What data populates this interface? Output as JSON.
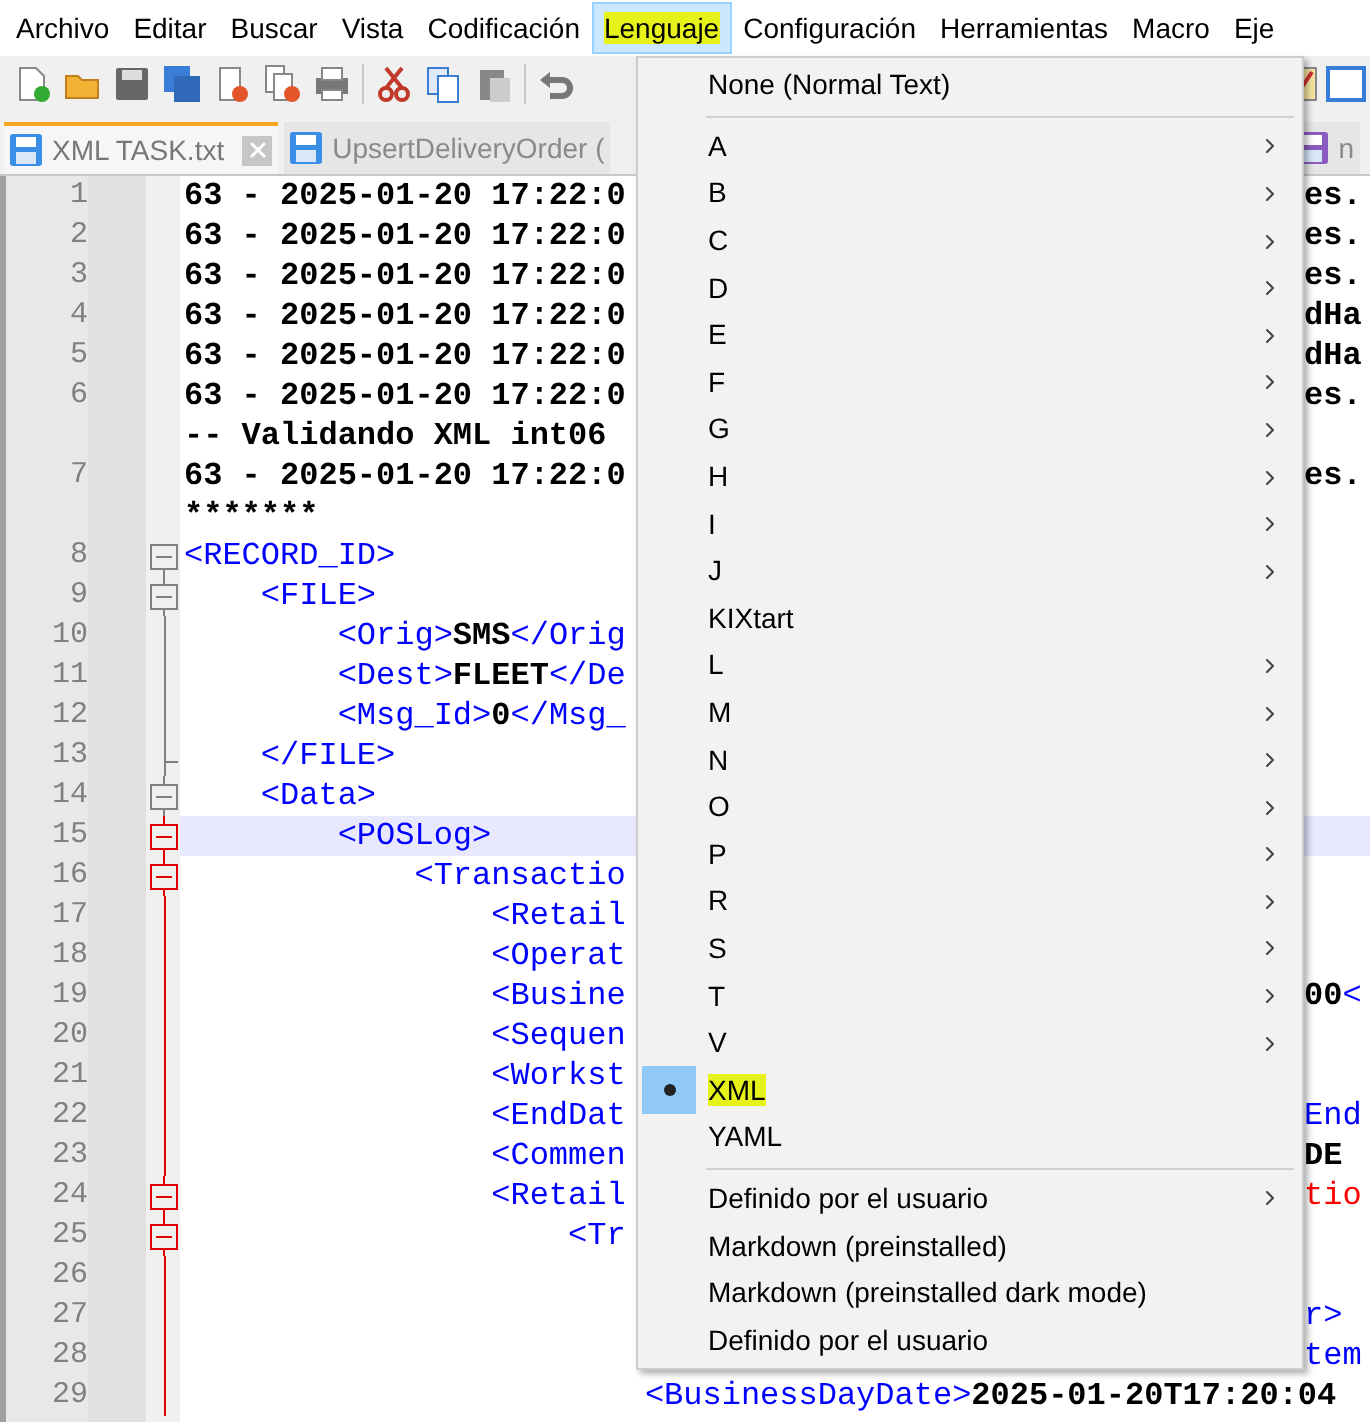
{
  "menubar": [
    {
      "label": "Archivo",
      "open": false,
      "highlighted": false
    },
    {
      "label": "Editar",
      "open": false,
      "highlighted": false
    },
    {
      "label": "Buscar",
      "open": false,
      "highlighted": false
    },
    {
      "label": "Vista",
      "open": false,
      "highlighted": false
    },
    {
      "label": "Codificación",
      "open": false,
      "highlighted": false
    },
    {
      "label": "Lenguaje",
      "open": true,
      "highlighted": true
    },
    {
      "label": "Configuración",
      "open": false,
      "highlighted": false
    },
    {
      "label": "Herramientas",
      "open": false,
      "highlighted": false
    },
    {
      "label": "Macro",
      "open": false,
      "highlighted": false
    },
    {
      "label": "Eje",
      "open": false,
      "highlighted": false
    }
  ],
  "tabs": [
    {
      "label": "XML TASK.txt",
      "selected": true,
      "color": "#3a8ee6"
    },
    {
      "label": "UpsertDeliveryOrder (",
      "selected": false,
      "color": "#3a8ee6"
    },
    {
      "label": "n",
      "selected": false,
      "color": "#8a5cc0"
    }
  ],
  "editor": {
    "lines": [
      {
        "number": "1",
        "current": false,
        "left": [
          {
            "kind": "text",
            "text": "63 - 2025-01-20 17:22:0"
          }
        ],
        "right": [
          {
            "kind": "text",
            "text": "es."
          }
        ]
      },
      {
        "number": "2",
        "current": false,
        "left": [
          {
            "kind": "text",
            "text": "63 - 2025-01-20 17:22:0"
          }
        ],
        "right": [
          {
            "kind": "text",
            "text": "es."
          }
        ]
      },
      {
        "number": "3",
        "current": false,
        "left": [
          {
            "kind": "text",
            "text": "63 - 2025-01-20 17:22:0"
          }
        ],
        "right": [
          {
            "kind": "text",
            "text": "es."
          }
        ]
      },
      {
        "number": "4",
        "current": false,
        "left": [
          {
            "kind": "text",
            "text": "63 - 2025-01-20 17:22:0"
          }
        ],
        "right": [
          {
            "kind": "text",
            "text": "dHa"
          }
        ]
      },
      {
        "number": "5",
        "current": false,
        "left": [
          {
            "kind": "text",
            "text": "63 - 2025-01-20 17:22:0"
          }
        ],
        "right": [
          {
            "kind": "text",
            "text": "dHa"
          }
        ]
      },
      {
        "number": "6",
        "current": false,
        "left": [
          {
            "kind": "text",
            "text": "63 - 2025-01-20 17:22:0"
          }
        ],
        "right": [
          {
            "kind": "text",
            "text": "es."
          }
        ]
      },
      {
        "current": false,
        "left": [
          {
            "kind": "text",
            "text": "-- Validando XML int06"
          }
        ]
      },
      {
        "number": "7",
        "current": false,
        "left": [
          {
            "kind": "text",
            "text": "63 - 2025-01-20 17:22:0"
          }
        ],
        "right": [
          {
            "kind": "text",
            "text": "es."
          }
        ]
      },
      {
        "current": false,
        "left": [
          {
            "kind": "text",
            "text": "*******"
          }
        ]
      },
      {
        "number": "8",
        "kind": "fold_root",
        "current": false,
        "current_block": false,
        "left": [
          {
            "kind": "tag",
            "text": "<RECORD_ID>"
          }
        ]
      },
      {
        "number": "9",
        "kind": "fold_open",
        "current": false,
        "current_block": false,
        "left": [
          {
            "kind": "tag",
            "text": "    <FILE>"
          }
        ]
      },
      {
        "number": "10",
        "kind": "fold_line",
        "current": false,
        "current_block": false,
        "left": [
          {
            "kind": "tag",
            "text": "        <Orig>"
          },
          {
            "kind": "text",
            "text": "SMS"
          },
          {
            "kind": "tag",
            "text": "</Orig"
          }
        ]
      },
      {
        "number": "11",
        "kind": "fold_line",
        "current": false,
        "current_block": false,
        "left": [
          {
            "kind": "tag",
            "text": "        <Dest>"
          },
          {
            "kind": "text",
            "text": "FLEET"
          },
          {
            "kind": "tag",
            "text": "</De"
          }
        ]
      },
      {
        "number": "12",
        "kind": "fold_line",
        "current": false,
        "current_block": false,
        "left": [
          {
            "kind": "tag",
            "text": "        <Msg_Id>"
          },
          {
            "kind": "text",
            "text": "0"
          },
          {
            "kind": "tag",
            "text": "</Msg_"
          }
        ]
      },
      {
        "number": "13",
        "kind": "fold_end",
        "current": false,
        "current_block": false,
        "left": [
          {
            "kind": "tag",
            "text": "    </FILE>"
          }
        ]
      },
      {
        "number": "14",
        "kind": "fold_open",
        "current": false,
        "current_block": false,
        "left": [
          {
            "kind": "tag",
            "text": "    <Data>"
          }
        ]
      },
      {
        "number": "15",
        "kind": "fold_open",
        "current": true,
        "current_block": true,
        "left": [
          {
            "kind": "tag",
            "text": "        <POSLog>"
          }
        ]
      },
      {
        "number": "16",
        "kind": "fold_open",
        "current": false,
        "current_block": true,
        "left": [
          {
            "kind": "tag",
            "text": "            <Transactio"
          }
        ]
      },
      {
        "number": "17",
        "kind": "fold_line",
        "current": false,
        "current_block": true,
        "left": [
          {
            "kind": "tag",
            "text": "                <Retail"
          }
        ]
      },
      {
        "number": "18",
        "kind": "fold_line",
        "current": false,
        "current_block": true,
        "left": [
          {
            "kind": "tag",
            "text": "                <Operat"
          }
        ]
      },
      {
        "number": "19",
        "kind": "fold_line",
        "current": false,
        "current_block": true,
        "left": [
          {
            "kind": "tag",
            "text": "                <Busine"
          }
        ],
        "right": [
          {
            "kind": "text",
            "text": "00"
          },
          {
            "kind": "tag",
            "text": "<"
          }
        ]
      },
      {
        "number": "20",
        "kind": "fold_line",
        "current": false,
        "current_block": true,
        "left": [
          {
            "kind": "tag",
            "text": "                <Sequen"
          }
        ]
      },
      {
        "number": "21",
        "kind": "fold_line",
        "current": false,
        "current_block": true,
        "left": [
          {
            "kind": "tag",
            "text": "                <Workst"
          }
        ]
      },
      {
        "number": "22",
        "kind": "fold_line",
        "current": false,
        "current_block": true,
        "left": [
          {
            "kind": "tag",
            "text": "                <EndDat"
          }
        ],
        "right": [
          {
            "kind": "tag",
            "text": "End"
          }
        ]
      },
      {
        "number": "23",
        "kind": "fold_line",
        "current": false,
        "current_block": true,
        "left": [
          {
            "kind": "tag",
            "text": "                <Commen"
          }
        ],
        "right": [
          {
            "kind": "text",
            "text": "DE"
          }
        ]
      },
      {
        "number": "24",
        "kind": "fold_open",
        "current": false,
        "current_block": true,
        "left": [
          {
            "kind": "tag",
            "text": "                <Retail"
          }
        ],
        "right": [
          {
            "kind": "attr",
            "text": "tio"
          }
        ]
      },
      {
        "number": "25",
        "kind": "fold_open",
        "current": false,
        "current_block": true,
        "left": [
          {
            "kind": "tag",
            "text": "                    <Tr"
          }
        ]
      },
      {
        "number": "26",
        "kind": "fold_line",
        "current": false,
        "current_block": true
      },
      {
        "number": "27",
        "kind": "fold_line",
        "current": false,
        "current_block": true,
        "right": [
          {
            "kind": "tag",
            "text": "r>"
          }
        ]
      },
      {
        "number": "28",
        "kind": "fold_line",
        "current": false,
        "current_block": true,
        "right": [
          {
            "kind": "tag",
            "text": "tem"
          }
        ]
      },
      {
        "number": "29",
        "kind": "fold_line",
        "current": false,
        "current_block": true,
        "left": [
          {
            "kind": "tag",
            "text": "                        <BusinessDayDate>"
          },
          {
            "kind": "text",
            "text": "2025-01-20T17:20:04"
          }
        ]
      }
    ]
  },
  "language_menu": {
    "items": [
      {
        "kind": "item",
        "label": "None (Normal Text)",
        "submenu": false,
        "selected": false,
        "highlighted": false
      },
      {
        "kind": "separator"
      },
      {
        "kind": "item",
        "label": "A",
        "submenu": true,
        "selected": false,
        "highlighted": false
      },
      {
        "kind": "item",
        "label": "B",
        "submenu": true,
        "selected": false,
        "highlighted": false
      },
      {
        "kind": "item",
        "label": "C",
        "submenu": true,
        "selected": false,
        "highlighted": false
      },
      {
        "kind": "item",
        "label": "D",
        "submenu": true,
        "selected": false,
        "highlighted": false
      },
      {
        "kind": "item",
        "label": "E",
        "submenu": true,
        "selected": false,
        "highlighted": false
      },
      {
        "kind": "item",
        "label": "F",
        "submenu": true,
        "selected": false,
        "highlighted": false
      },
      {
        "kind": "item",
        "label": "G",
        "submenu": true,
        "selected": false,
        "highlighted": false
      },
      {
        "kind": "item",
        "label": "H",
        "submenu": true,
        "selected": false,
        "highlighted": false
      },
      {
        "kind": "item",
        "label": "I",
        "submenu": true,
        "selected": false,
        "highlighted": false
      },
      {
        "kind": "item",
        "label": "J",
        "submenu": true,
        "selected": false,
        "highlighted": false
      },
      {
        "kind": "item",
        "label": "KIXtart",
        "submenu": false,
        "selected": false,
        "highlighted": false
      },
      {
        "kind": "item",
        "label": "L",
        "submenu": true,
        "selected": false,
        "highlighted": false
      },
      {
        "kind": "item",
        "label": "M",
        "submenu": true,
        "selected": false,
        "highlighted": false
      },
      {
        "kind": "item",
        "label": "N",
        "submenu": true,
        "selected": false,
        "highlighted": false
      },
      {
        "kind": "item",
        "label": "O",
        "submenu": true,
        "selected": false,
        "highlighted": false
      },
      {
        "kind": "item",
        "label": "P",
        "submenu": true,
        "selected": false,
        "highlighted": false
      },
      {
        "kind": "item",
        "label": "R",
        "submenu": true,
        "selected": false,
        "highlighted": false
      },
      {
        "kind": "item",
        "label": "S",
        "submenu": true,
        "selected": false,
        "highlighted": false
      },
      {
        "kind": "item",
        "label": "T",
        "submenu": true,
        "selected": false,
        "highlighted": false
      },
      {
        "kind": "item",
        "label": "V",
        "submenu": true,
        "selected": false,
        "highlighted": false
      },
      {
        "kind": "item",
        "label": "XML",
        "submenu": false,
        "selected": true,
        "highlighted": true
      },
      {
        "kind": "item",
        "label": "YAML",
        "submenu": false,
        "selected": false,
        "highlighted": false
      },
      {
        "kind": "separator"
      },
      {
        "kind": "item",
        "label": "Definido por el usuario",
        "submenu": true,
        "selected": false,
        "highlighted": false
      },
      {
        "kind": "item",
        "label": "Markdown (preinstalled)",
        "submenu": false,
        "selected": false,
        "highlighted": false
      },
      {
        "kind": "item",
        "label": "Markdown (preinstalled dark mode)",
        "submenu": false,
        "selected": false,
        "highlighted": false
      },
      {
        "kind": "item",
        "label": "Definido por el usuario",
        "submenu": false,
        "selected": false,
        "highlighted": false
      }
    ]
  }
}
